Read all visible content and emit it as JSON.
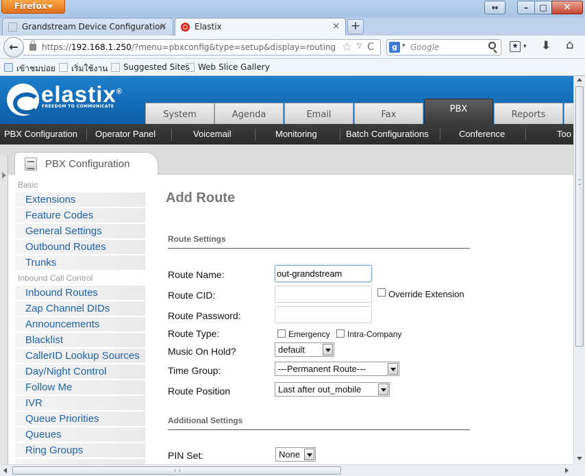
{
  "browser": {
    "app_menu_label": "Firefox",
    "window_button_glyphs": {
      "swap": "⇔",
      "minimize": "–",
      "maximize": "□",
      "close": "✕"
    },
    "tabs": [
      {
        "title": "Grandstream Device Configuration",
        "close_glyph": "×"
      },
      {
        "title": "Elastix",
        "close_glyph": "×"
      }
    ],
    "new_tab_glyph": "+",
    "back_glyph": "←",
    "url": {
      "scheme": "https://",
      "host": "192.168.1.250",
      "path": "/?menu=pbxconfig&type=setup&display=routing"
    },
    "star_glyph": "☆",
    "dropdown_glyph": "▽",
    "reload_glyph": "C",
    "search": {
      "engine_icon": "g",
      "placeholder": "Google",
      "dropdown_glyph": "▾"
    },
    "bookmarks_glyph": "★",
    "bookmarks_dropdown_glyph": "▾",
    "download_glyph": "⬇",
    "home_glyph": "⌂",
    "bookmarks": [
      "เข้าชมบ่อย",
      "เริ่มใช้งาน",
      "Suggested Sites",
      "Web Slice Gallery"
    ]
  },
  "elastix": {
    "brand": "elastix",
    "brand_mark": "®",
    "tagline": "FREEDOM TO COMMUNICATE",
    "main_tabs": [
      "System",
      "Agenda",
      "Email",
      "Fax",
      "PBX",
      "Reports"
    ],
    "active_main_tab": "PBX",
    "submenu": [
      "PBX Configuration",
      "Operator Panel",
      "Voicemail",
      "Monitoring",
      "Batch Configurations",
      "Conference",
      "Too"
    ],
    "module_title": "PBX Configuration"
  },
  "sidebar": {
    "basic_heading": "Basic",
    "basic_items": [
      "Extensions",
      "Feature Codes",
      "General Settings",
      "Outbound Routes",
      "Trunks"
    ],
    "inbound_heading": "Inbound Call Control",
    "inbound_items": [
      "Inbound Routes",
      "Zap Channel DIDs",
      "Announcements",
      "Blacklist",
      "CallerID Lookup Sources",
      "Day/Night Control",
      "Follow Me",
      "IVR",
      "Queue Priorities",
      "Queues",
      "Ring Groups"
    ]
  },
  "form": {
    "page_title": "Add Route",
    "route_settings_heading": "Route Settings",
    "route_name_label": "Route Name:",
    "route_name_value": "out-grandstream",
    "route_cid_label": "Route CID:",
    "route_cid_value": "",
    "override_extension_label": "Override Extension",
    "route_password_label": "Route Password:",
    "route_password_value": "",
    "route_type_label": "Route Type:",
    "emergency_label": "Emergency",
    "intra_company_label": "Intra-Company",
    "music_on_hold_label": "Music On Hold?",
    "music_on_hold_value": "default",
    "time_group_label": "Time Group:",
    "time_group_value": "---Permanent Route---",
    "route_position_label": "Route Position",
    "route_position_value": "Last after out_mobile",
    "additional_settings_heading": "Additional Settings",
    "pin_set_label": "PIN Set:",
    "pin_set_value": "None"
  },
  "colors": {
    "link": "#1d62a8",
    "header_blue": "#0f6bb6",
    "active_tab": "#4a4a4a"
  }
}
